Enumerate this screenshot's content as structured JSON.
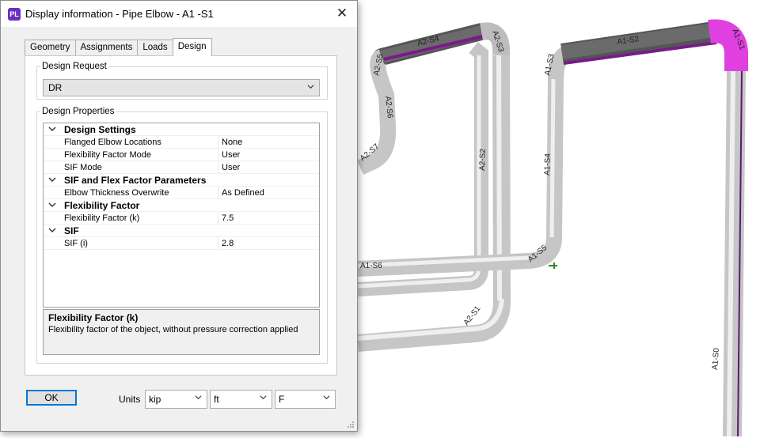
{
  "window": {
    "app_icon_text": "PL",
    "title": "Display information - Pipe Elbow - A1 -S1",
    "close_glyph": "✕"
  },
  "tabs": [
    {
      "label": "Geometry",
      "active": false
    },
    {
      "label": "Assignments",
      "active": false
    },
    {
      "label": "Loads",
      "active": false
    },
    {
      "label": "Design",
      "active": true
    }
  ],
  "design_request": {
    "legend": "Design Request",
    "selected": "DR"
  },
  "design_properties": {
    "legend": "Design Properties",
    "categories": [
      {
        "label": "Design Settings",
        "rows": [
          {
            "name": "Flanged Elbow Locations",
            "value": "None"
          },
          {
            "name": "Flexibility Factor Mode",
            "value": "User"
          },
          {
            "name": "SIF Mode",
            "value": "User"
          }
        ]
      },
      {
        "label": "SIF and Flex Factor Parameters",
        "rows": [
          {
            "name": "Elbow Thickness Overwrite",
            "value": "As Defined"
          }
        ]
      },
      {
        "label": "Flexibility Factor",
        "rows": [
          {
            "name": "Flexibility Factor (k)",
            "value": "7.5"
          }
        ]
      },
      {
        "label": "SIF",
        "rows": [
          {
            "name": "SIF (i)",
            "value": "2.8"
          }
        ]
      }
    ],
    "description": {
      "title": "Flexibility Factor (k)",
      "text": "Flexibility factor of the object, without pressure correction applied"
    }
  },
  "footer": {
    "ok_label": "OK",
    "units_label": "Units",
    "force_unit": "kip",
    "length_unit": "ft",
    "temp_unit": "F"
  },
  "viewport": {
    "segment_labels": [
      "A2-S4",
      "A2-S3",
      "A2-S5",
      "A2-S6",
      "A2-S7",
      "A2-S2",
      "A2-S1",
      "A1-S2",
      "A1-S1",
      "A1-S3",
      "A1-S4",
      "A1-S5",
      "A1-S6",
      "A1-S0"
    ],
    "colors": {
      "pipe": "#d4d4d4",
      "highlight": "#e040e0",
      "selection_edge": "#7a1a8a"
    }
  }
}
